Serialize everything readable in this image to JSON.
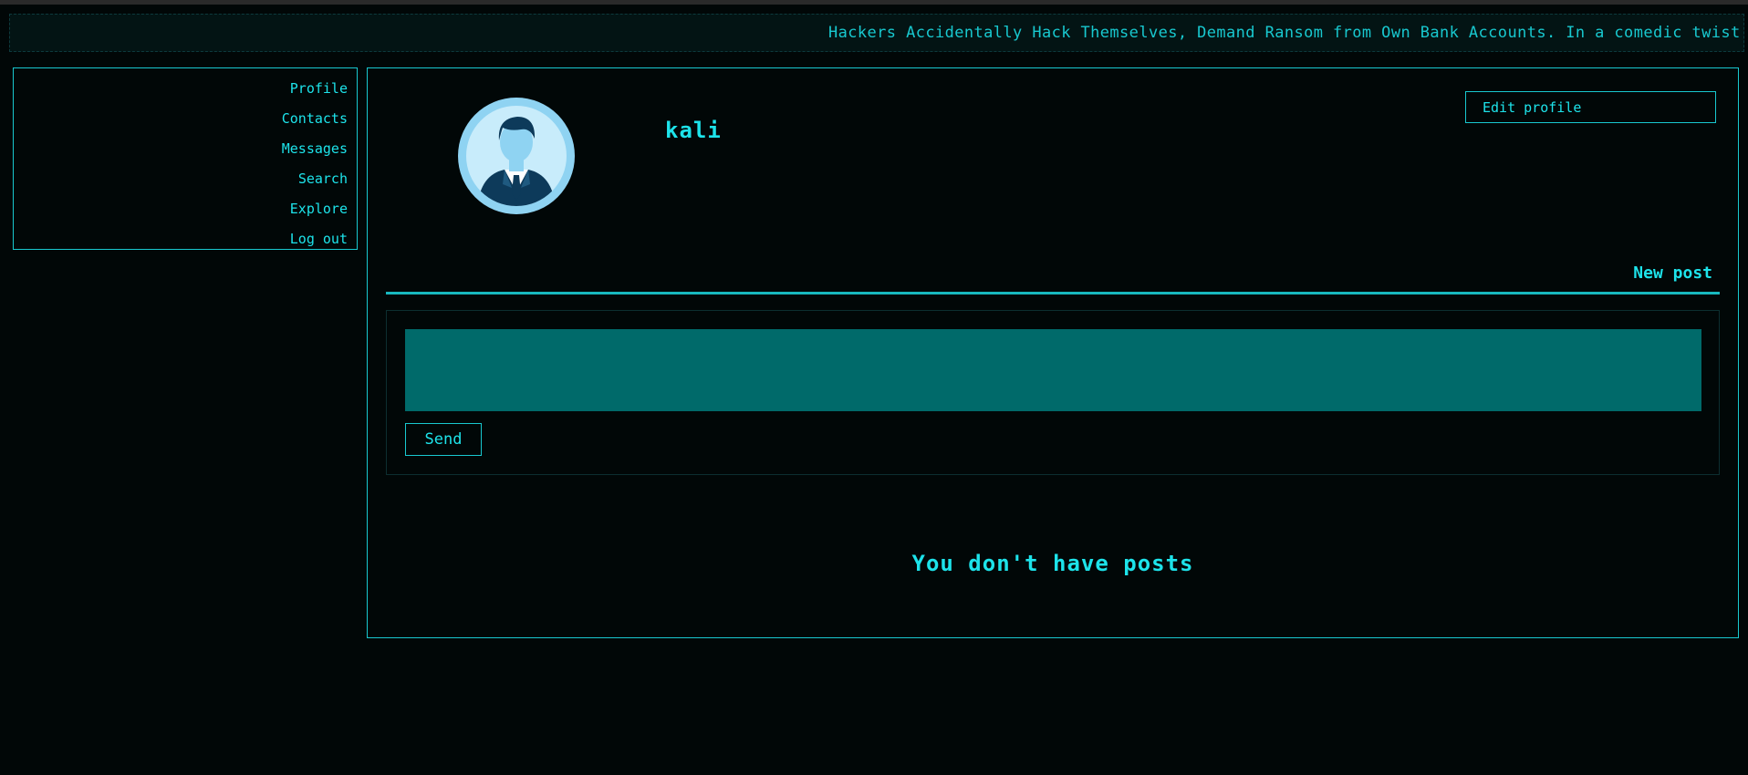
{
  "ticker": {
    "text": "Hackers Accidentally Hack Themselves, Demand Ransom from Own Bank Accounts. In a comedic twist"
  },
  "sidebar": {
    "items": [
      {
        "label": "Profile"
      },
      {
        "label": "Contacts"
      },
      {
        "label": "Messages"
      },
      {
        "label": "Search"
      },
      {
        "label": "Explore"
      },
      {
        "label": "Log out"
      }
    ]
  },
  "profile": {
    "username": "kali",
    "edit_label": "Edit profile",
    "avatar_icon": "user-avatar-icon"
  },
  "new_post": {
    "label": "New post",
    "textarea_value": "",
    "send_label": "Send"
  },
  "posts": {
    "empty_message": "You don't have posts"
  },
  "colors": {
    "accent": "#1de3ea",
    "background": "#010707",
    "textarea_bg": "#006a6a"
  }
}
